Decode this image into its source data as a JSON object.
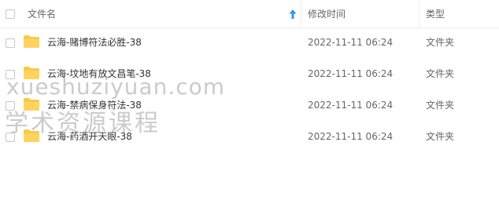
{
  "header": {
    "name_label": "文件名",
    "modified_label": "修改时间",
    "type_label": "类型"
  },
  "rows": [
    {
      "name": "云海-赌博符法必胜-38",
      "modified": "2022-11-11 06:24",
      "type": "文件夹"
    },
    {
      "name": "云海-坟地有放文昌笔-38",
      "modified": "2022-11-11 06:24",
      "type": "文件夹"
    },
    {
      "name": "云海-禁病保身符法-38",
      "modified": "2022-11-11 06:24",
      "type": "文件夹"
    },
    {
      "name": "云海-药酒开天眼-38",
      "modified": "2022-11-11 06:24",
      "type": "文件夹"
    }
  ],
  "watermark": {
    "line1": "xueshuziyuan.com",
    "line2": "学术资源课程"
  },
  "colors": {
    "folder": "#f7c94b",
    "sort_arrow": "#2e9ae6"
  }
}
